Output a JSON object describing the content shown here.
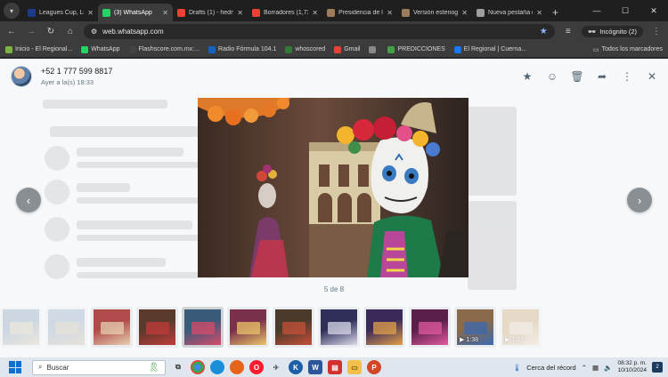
{
  "browser": {
    "tabs": [
      {
        "label": "Leagues Cup, Lig",
        "fav_color": "#1e3a8a",
        "active": false
      },
      {
        "label": "(3) WhatsApp",
        "fav_color": "#25d366",
        "active": true
      },
      {
        "label": "Drafts (1) - hedn",
        "fav_color": "#ea4335",
        "active": false
      },
      {
        "label": "Borradores (1,73",
        "fav_color": "#ea4335",
        "active": false
      },
      {
        "label": "Presidencia de la",
        "fav_color": "#9c7c5b",
        "active": false
      },
      {
        "label": "Versión estenogr",
        "fav_color": "#9c7c5b",
        "active": false
      },
      {
        "label": "Nueva pestaña d",
        "fav_color": "#9e9e9e",
        "active": false
      }
    ],
    "new_tab": "+",
    "url": "web.whatsapp.com",
    "incognito_label": "Incógnito (2)",
    "bookmarks": [
      {
        "label": "Inicio - El Regional...",
        "color": "#7cb342"
      },
      {
        "label": "WhatsApp",
        "color": "#25d366"
      },
      {
        "label": "Flashscore.com.mx:...",
        "color": "#444"
      },
      {
        "label": "Radio Fórmula 104.1",
        "color": "#1565c0"
      },
      {
        "label": "whoscored",
        "color": "#2e7d32"
      },
      {
        "label": "Gmail",
        "color": "#ea4335"
      },
      {
        "label": "",
        "color": "#888"
      },
      {
        "label": "PREDICCIONES",
        "color": "#43a047"
      },
      {
        "label": "El Regional | Cuerna...",
        "color": "#1877f2"
      }
    ],
    "all_bookmarks": "Todos los marcadores"
  },
  "viewer": {
    "sender_name": "+52 1 777 599 8817",
    "sent_time": "Ayer a la(s) 18:33",
    "counter": "5 de 8",
    "thumbnails": [
      {
        "video": false,
        "duration": ""
      },
      {
        "video": false,
        "duration": ""
      },
      {
        "video": false,
        "duration": ""
      },
      {
        "video": false,
        "duration": ""
      },
      {
        "video": false,
        "duration": ""
      },
      {
        "video": false,
        "duration": ""
      },
      {
        "video": false,
        "duration": ""
      },
      {
        "video": false,
        "duration": ""
      },
      {
        "video": false,
        "duration": ""
      },
      {
        "video": false,
        "duration": ""
      },
      {
        "video": true,
        "duration": "1:38"
      },
      {
        "video": true,
        "duration": "1:27"
      }
    ]
  },
  "taskbar": {
    "search_placeholder": "Buscar",
    "weather": "Cerca del récord",
    "time": "08:32 p. m.",
    "date": "10/10/2024",
    "notifications": "2"
  }
}
